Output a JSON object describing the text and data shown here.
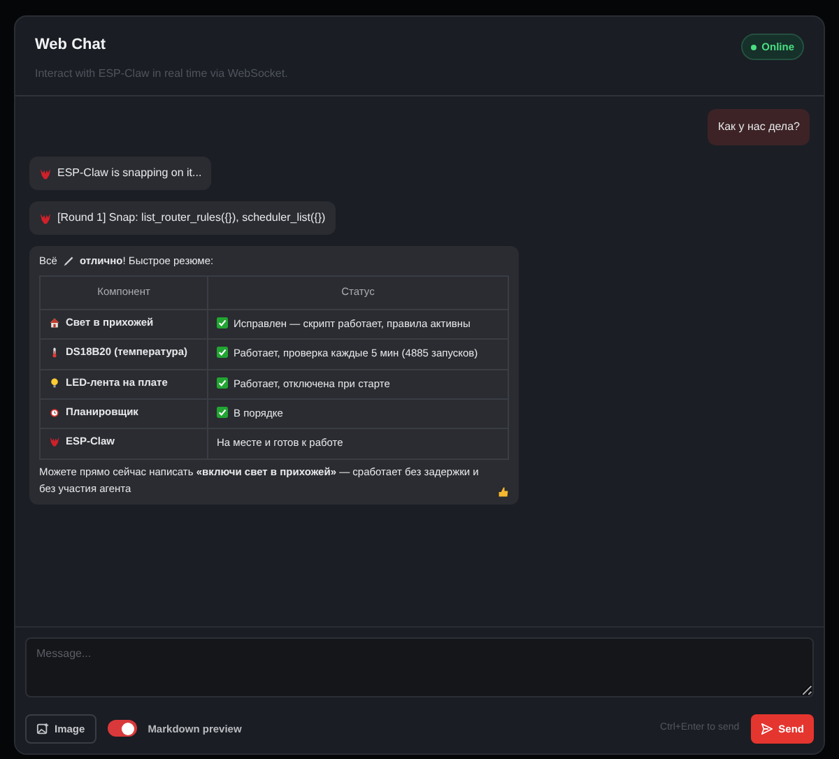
{
  "header": {
    "title": "Web Chat",
    "subtitle": "Interact with ESP-Claw in real time via WebSocket.",
    "status": {
      "label": "Online",
      "online": true
    }
  },
  "messages": [
    {
      "kind": "user",
      "text": "Как у нас дела?"
    },
    {
      "kind": "status",
      "text": "ESP-Claw is snapping on it..."
    },
    {
      "kind": "status",
      "text": "[Round 1] Snap: list_router_rules({}), scheduler_list({})"
    },
    {
      "kind": "reply",
      "intro": "Всё",
      "intro_rest": "**отлично**! Быстрое резюме:",
      "table": {
        "columns": [
          "Компонент",
          "Статус"
        ],
        "rows": [
          {
            "component": "Свет в прихожей",
            "status": "Исправлен — скрипт работает, правила активны",
            "ok": true
          },
          {
            "component": "DS18B20 (температура)",
            "status": "Работает, проверка каждые 5 мин (4885 запусков)",
            "ok": true
          },
          {
            "component": "LED-лента на плате",
            "status": "Работает, отключена при старте",
            "ok": true
          },
          {
            "component": "Планировщик",
            "status": "В порядке",
            "ok": true
          },
          {
            "component": "ESP-Claw",
            "status": "На месте и готов к работе",
            "ok": false
          }
        ]
      },
      "outro": "Можете прямо сейчас написать **«включи свет в прихожей»** — сработает без задержки и без участия агента"
    }
  ],
  "composer": {
    "placeholder": "Message...",
    "image_button": "Image",
    "markdown_preview": {
      "label": "Markdown preview",
      "on": true
    },
    "hint": "Ctrl+Enter to send",
    "send_button": "Send"
  }
}
